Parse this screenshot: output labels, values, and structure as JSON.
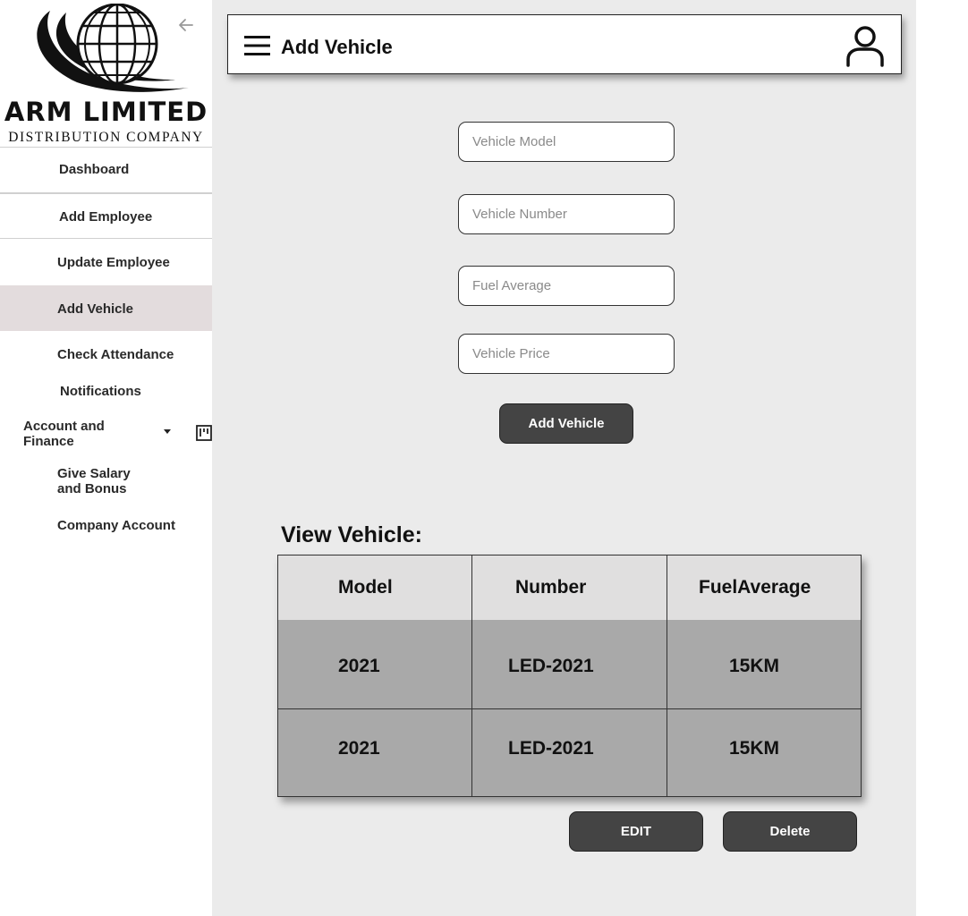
{
  "logo": {
    "title": "ARM LIMITED",
    "subtitle": "DISTRIBUTION COMPANY"
  },
  "sidebar": {
    "items": [
      {
        "label": "Dashboard"
      },
      {
        "label": "Add Employee"
      },
      {
        "label": "Update Employee"
      },
      {
        "label": "Add Vehicle",
        "active": true
      },
      {
        "label": "Check Attendance"
      },
      {
        "label": "Notifications"
      },
      {
        "label": "Account and\nFinance"
      },
      {
        "label": "Give Salary\nand Bonus"
      },
      {
        "label": "Company Account"
      }
    ]
  },
  "header": {
    "title": "Add Vehicle",
    "menu_icon": "hamburger-menu-icon",
    "user_icon": "user-profile-icon"
  },
  "form": {
    "model_placeholder": "Vehicle Model",
    "number_placeholder": "Vehicle Number",
    "fuel_placeholder": "Fuel Average",
    "price_placeholder": "Vehicle Price",
    "submit_label": "Add Vehicle"
  },
  "view": {
    "title": "View Vehicle:",
    "columns": [
      "Model",
      "Number",
      "FuelAverage"
    ],
    "rows": [
      [
        "2021",
        "LED-2021",
        "15KM"
      ],
      [
        "2021",
        "LED-2021",
        "15KM"
      ]
    ],
    "edit_label": "EDIT",
    "delete_label": "Delete"
  },
  "colors": {
    "button": "#444444",
    "active_nav": "#e3dcdd",
    "main_bg": "#ebebeb",
    "table_body": "#a9a9a9",
    "table_head": "#e0dfdf"
  }
}
